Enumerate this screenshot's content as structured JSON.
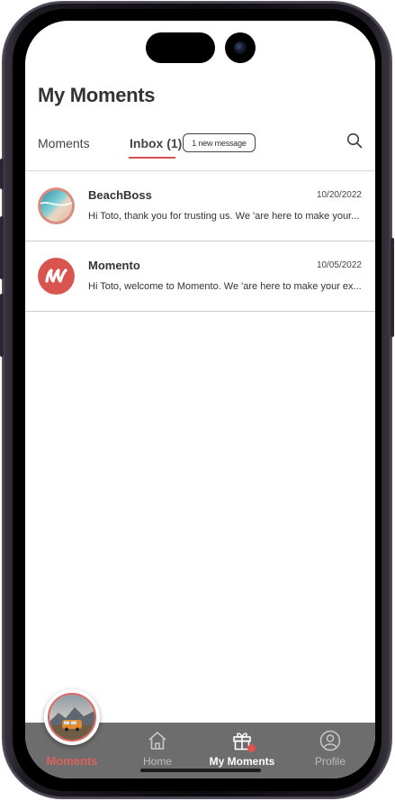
{
  "header": {
    "title": "My Moments"
  },
  "tabs": {
    "moments_label": "Moments",
    "inbox_label": "Inbox (1)",
    "new_message_badge": "1 new message",
    "search_icon": "search-icon"
  },
  "messages": [
    {
      "sender": "BeachBoss",
      "date": "10/20/2022",
      "preview": "Hi Toto, thank you for trusting us. We 'are here to make your...",
      "avatar": "beach-photo"
    },
    {
      "sender": "Momento",
      "date": "10/05/2022",
      "preview": "Hi Toto, welcome to Momento. We 'are here to make your ex...",
      "avatar": "momento-logo"
    }
  ],
  "nav": {
    "items": [
      {
        "label": "Moments",
        "icon": "van-photo-avatar",
        "state": "accent"
      },
      {
        "label": "Home",
        "icon": "home-icon",
        "state": "inactive"
      },
      {
        "label": "My Moments",
        "icon": "gift-icon",
        "state": "active"
      },
      {
        "label": "Profile",
        "icon": "user-circle-icon",
        "state": "inactive"
      }
    ]
  },
  "colors": {
    "accent": "#d9534f",
    "nav_background": "#6d6d6d",
    "text": "#333333"
  }
}
